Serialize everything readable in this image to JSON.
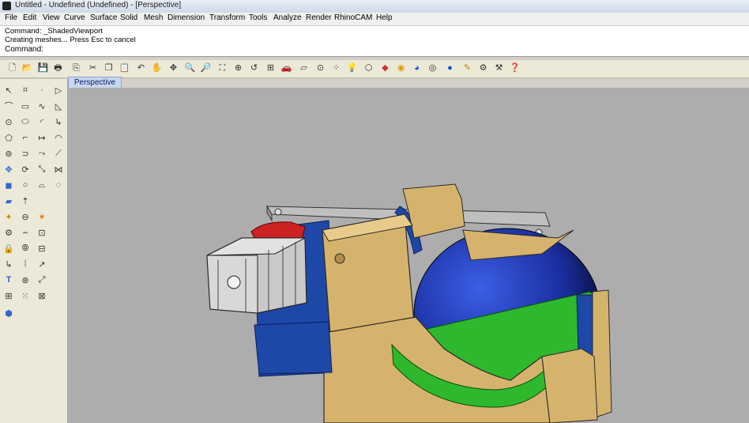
{
  "window": {
    "title": "Untitled - Undefined (Undefined) - [Perspective]"
  },
  "menu": [
    "File",
    "Edit",
    "View",
    "Curve",
    "Surface",
    "Solid",
    "Mesh",
    "Dimension",
    "Transform",
    "Tools",
    "Analyze",
    "Render",
    "RhinoCAM",
    "Help"
  ],
  "command_history": {
    "line1": "Command: _ShadedViewport",
    "line2": "Creating meshes... Press Esc to cancel"
  },
  "command_prompt": {
    "label": "Command:",
    "value": ""
  },
  "viewport": {
    "tab_label": "Perspective"
  },
  "toolbar_icons": [
    "new-file-icon",
    "open-file-icon",
    "save-icon",
    "print-icon",
    "import-icon",
    "cut-icon",
    "copy-icon",
    "paste-icon",
    "undo-icon",
    "pan-hand-icon",
    "rotate-view-icon",
    "zoom-dynamic-icon",
    "zoom-window-icon",
    "zoom-extents-icon",
    "zoom-selected-icon",
    "undo-view-icon",
    "four-viewports-icon",
    "car-icon",
    "cplane-icon",
    "grid-snap-icon",
    "select-points-icon",
    "light-icon",
    "render-icon",
    "layer-icon",
    "color-wheel-icon",
    "material-icon",
    "environment-icon",
    "render-sphere-icon",
    "rhinocam-icon",
    "options-gear-icon",
    "settings-icon",
    "help-icon"
  ],
  "colors": {
    "viewport_bg": "#adadad",
    "tan_part": "#d6b36c",
    "blue_sphere": "#1a2e9e",
    "green_part": "#2eb82e",
    "motor_gray": "#c9c9c9",
    "red_part": "#cc2222"
  }
}
